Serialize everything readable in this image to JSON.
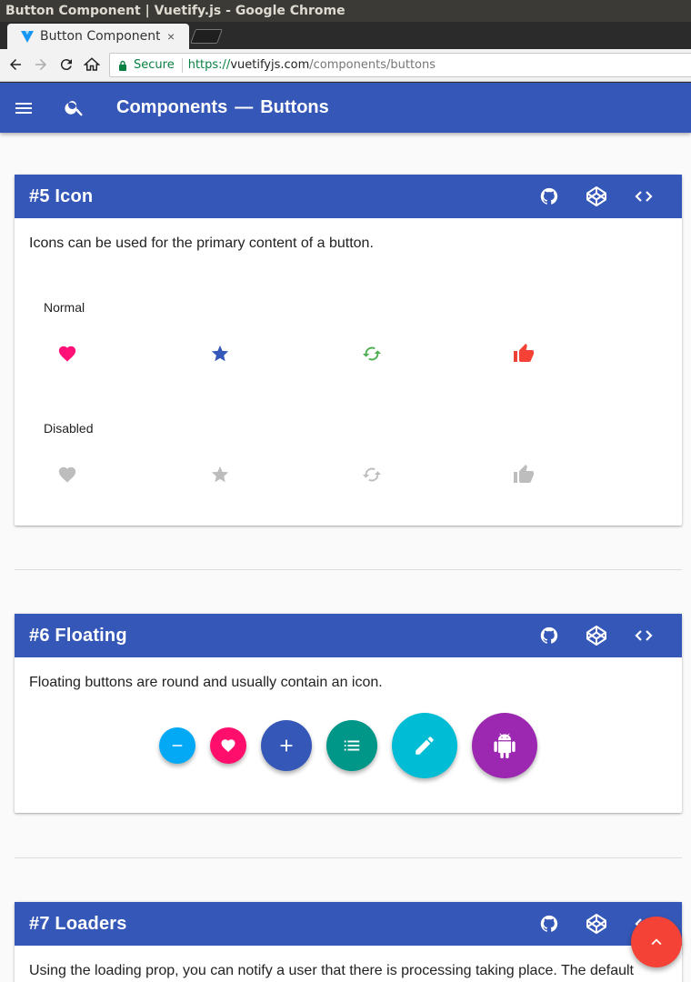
{
  "window": {
    "title": "Button Component | Vuetify.js - Google Chrome"
  },
  "browser": {
    "tab_title": "Button Component",
    "tab_close": "×",
    "secure_label": "Secure",
    "url_scheme": "https://",
    "url_host": "vuetifyjs.com",
    "url_path": "/components/buttons"
  },
  "appbar": {
    "section": "Components",
    "dash": "—",
    "page": "Buttons",
    "color": "#3557b7"
  },
  "cards": {
    "icon": {
      "title": "#5 Icon",
      "description": "Icons can be used for the primary content of a button.",
      "normal_label": "Normal",
      "disabled_label": "Disabled",
      "normal_icons": [
        {
          "name": "heart-icon",
          "color": "#ff1177"
        },
        {
          "name": "star-icon",
          "color": "#3557b7"
        },
        {
          "name": "cached-icon",
          "color": "#4caf50"
        },
        {
          "name": "thumb-up-icon",
          "color": "#f44336"
        }
      ],
      "disabled_color": "#bdbdbd"
    },
    "floating": {
      "title": "#6 Floating",
      "description": "Floating buttons are round and usually contain an icon.",
      "fabs": [
        {
          "icon": "remove-icon",
          "color": "#03a9f4",
          "size": "small"
        },
        {
          "icon": "heart-icon",
          "color": "#ff0f6b",
          "size": "small"
        },
        {
          "icon": "add-icon",
          "color": "#3557b7",
          "size": "normal"
        },
        {
          "icon": "list-icon",
          "color": "#009688",
          "size": "normal"
        },
        {
          "icon": "edit-icon",
          "color": "#00bcd4",
          "size": "large"
        },
        {
          "icon": "android-icon",
          "color": "#9c27b0",
          "size": "large"
        }
      ]
    },
    "loaders": {
      "title": "#7 Loaders",
      "description": "Using the loading prop, you can notify a user that there is processing taking place. The default"
    }
  },
  "scroll_top": {
    "icon": "chevron-up-icon",
    "color": "#f44336"
  }
}
